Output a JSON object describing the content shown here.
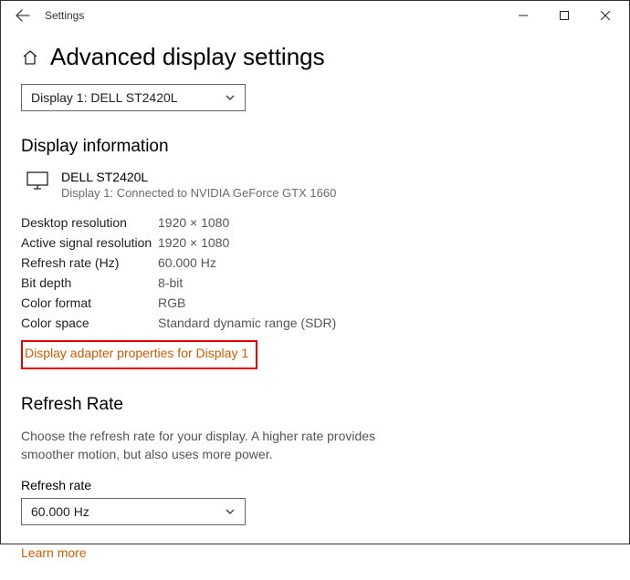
{
  "titlebar": {
    "title": "Settings"
  },
  "page": {
    "heading": "Advanced display settings",
    "display_selector": "Display 1: DELL ST2420L"
  },
  "section_info": {
    "heading": "Display information",
    "monitor_name": "DELL ST2420L",
    "monitor_desc": "Display 1: Connected to NVIDIA GeForce GTX 1660",
    "rows": [
      {
        "label": "Desktop resolution",
        "value": "1920 × 1080"
      },
      {
        "label": "Active signal resolution",
        "value": "1920 × 1080"
      },
      {
        "label": "Refresh rate (Hz)",
        "value": "60.000 Hz"
      },
      {
        "label": "Bit depth",
        "value": "8-bit"
      },
      {
        "label": "Color format",
        "value": "RGB"
      },
      {
        "label": "Color space",
        "value": "Standard dynamic range (SDR)"
      }
    ],
    "adapter_link": "Display adapter properties for Display 1"
  },
  "section_refresh": {
    "heading": "Refresh Rate",
    "description": "Choose the refresh rate for your display. A higher rate provides smoother motion, but also uses more power.",
    "field_label": "Refresh rate",
    "selected": "60.000 Hz",
    "learn_more": "Learn more"
  }
}
